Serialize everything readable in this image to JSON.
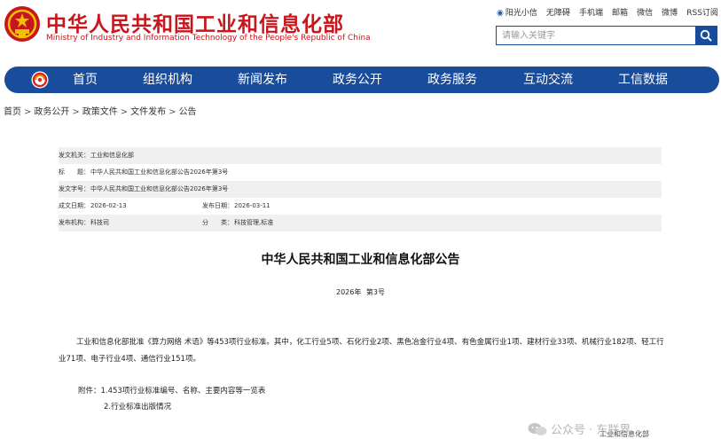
{
  "header": {
    "title_cn": "中华人民共和国工业和信息化部",
    "title_en": "Ministry of Industry and Information Technology of the People's Republic of China",
    "top_links": [
      "阳光小信",
      "无障碍",
      "手机端",
      "邮箱",
      "微信",
      "微博",
      "RSS订阅"
    ],
    "search_placeholder": "请输入关键字"
  },
  "nav": {
    "items": [
      "首页",
      "组织机构",
      "新闻发布",
      "政务公开",
      "政务服务",
      "互动交流",
      "工信数据"
    ]
  },
  "breadcrumb": [
    "首页",
    "政务公开",
    "政策文件",
    "文件发布",
    "公告"
  ],
  "meta": {
    "issuer_label": "发文机关：",
    "issuer": "工业和信息化部",
    "subject_label": "标　　题：",
    "subject": "中华人民共和国工业和信息化部公告2026年第3号",
    "docno_label": "发文字号：",
    "docno": "中华人民共和国工业和信息化部公告2026年第3号",
    "created_label": "成文日期：",
    "created": "2026-02-13",
    "published_label": "发布日期：",
    "published": "2026-03-11",
    "agency_label": "发布机构：",
    "agency": "科技司",
    "category_label": "分　　类：",
    "category": "科技管理,标准"
  },
  "document": {
    "title": "中华人民共和国工业和信息化部公告",
    "number": "2026年 第3号",
    "paragraph": "工业和信息化部批准《算力网络 术语》等453项行业标准。其中，化工行业5项、石化行业2项、黑色冶金行业4项、有色金属行业1项、建材行业33项、机械行业182项、轻工行业71项、电子行业4项、通信行业151项。",
    "attachment_1": "附件：1.453项行业标准编号、名称、主要内容等一览表",
    "attachment_2": "2.行业标准出版情况"
  },
  "overlay": {
    "watermark": "公众号 · 东联界",
    "partial_text": "工业和信息化部"
  },
  "colors": {
    "brand_red": "#c8161d",
    "nav_blue": "#1a4c9c",
    "row_shade": "#f0f0f0"
  }
}
